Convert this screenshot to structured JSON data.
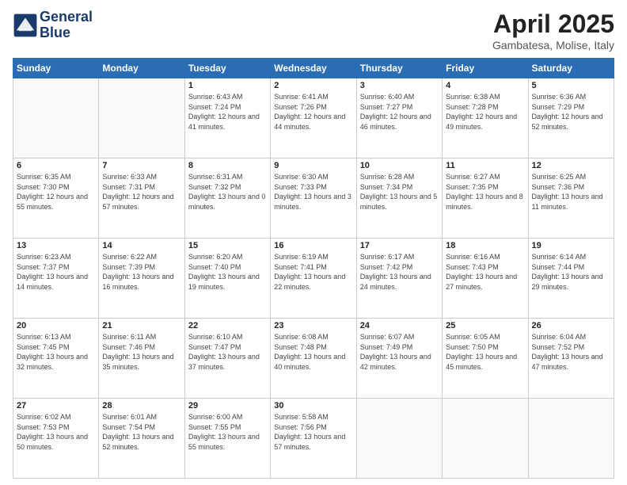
{
  "header": {
    "logo_line1": "General",
    "logo_line2": "Blue",
    "month_title": "April 2025",
    "location": "Gambatesa, Molise, Italy"
  },
  "days_of_week": [
    "Sunday",
    "Monday",
    "Tuesday",
    "Wednesday",
    "Thursday",
    "Friday",
    "Saturday"
  ],
  "weeks": [
    [
      {
        "day": "",
        "info": ""
      },
      {
        "day": "",
        "info": ""
      },
      {
        "day": "1",
        "info": "Sunrise: 6:43 AM\nSunset: 7:24 PM\nDaylight: 12 hours and 41 minutes."
      },
      {
        "day": "2",
        "info": "Sunrise: 6:41 AM\nSunset: 7:26 PM\nDaylight: 12 hours and 44 minutes."
      },
      {
        "day": "3",
        "info": "Sunrise: 6:40 AM\nSunset: 7:27 PM\nDaylight: 12 hours and 46 minutes."
      },
      {
        "day": "4",
        "info": "Sunrise: 6:38 AM\nSunset: 7:28 PM\nDaylight: 12 hours and 49 minutes."
      },
      {
        "day": "5",
        "info": "Sunrise: 6:36 AM\nSunset: 7:29 PM\nDaylight: 12 hours and 52 minutes."
      }
    ],
    [
      {
        "day": "6",
        "info": "Sunrise: 6:35 AM\nSunset: 7:30 PM\nDaylight: 12 hours and 55 minutes."
      },
      {
        "day": "7",
        "info": "Sunrise: 6:33 AM\nSunset: 7:31 PM\nDaylight: 12 hours and 57 minutes."
      },
      {
        "day": "8",
        "info": "Sunrise: 6:31 AM\nSunset: 7:32 PM\nDaylight: 13 hours and 0 minutes."
      },
      {
        "day": "9",
        "info": "Sunrise: 6:30 AM\nSunset: 7:33 PM\nDaylight: 13 hours and 3 minutes."
      },
      {
        "day": "10",
        "info": "Sunrise: 6:28 AM\nSunset: 7:34 PM\nDaylight: 13 hours and 5 minutes."
      },
      {
        "day": "11",
        "info": "Sunrise: 6:27 AM\nSunset: 7:35 PM\nDaylight: 13 hours and 8 minutes."
      },
      {
        "day": "12",
        "info": "Sunrise: 6:25 AM\nSunset: 7:36 PM\nDaylight: 13 hours and 11 minutes."
      }
    ],
    [
      {
        "day": "13",
        "info": "Sunrise: 6:23 AM\nSunset: 7:37 PM\nDaylight: 13 hours and 14 minutes."
      },
      {
        "day": "14",
        "info": "Sunrise: 6:22 AM\nSunset: 7:39 PM\nDaylight: 13 hours and 16 minutes."
      },
      {
        "day": "15",
        "info": "Sunrise: 6:20 AM\nSunset: 7:40 PM\nDaylight: 13 hours and 19 minutes."
      },
      {
        "day": "16",
        "info": "Sunrise: 6:19 AM\nSunset: 7:41 PM\nDaylight: 13 hours and 22 minutes."
      },
      {
        "day": "17",
        "info": "Sunrise: 6:17 AM\nSunset: 7:42 PM\nDaylight: 13 hours and 24 minutes."
      },
      {
        "day": "18",
        "info": "Sunrise: 6:16 AM\nSunset: 7:43 PM\nDaylight: 13 hours and 27 minutes."
      },
      {
        "day": "19",
        "info": "Sunrise: 6:14 AM\nSunset: 7:44 PM\nDaylight: 13 hours and 29 minutes."
      }
    ],
    [
      {
        "day": "20",
        "info": "Sunrise: 6:13 AM\nSunset: 7:45 PM\nDaylight: 13 hours and 32 minutes."
      },
      {
        "day": "21",
        "info": "Sunrise: 6:11 AM\nSunset: 7:46 PM\nDaylight: 13 hours and 35 minutes."
      },
      {
        "day": "22",
        "info": "Sunrise: 6:10 AM\nSunset: 7:47 PM\nDaylight: 13 hours and 37 minutes."
      },
      {
        "day": "23",
        "info": "Sunrise: 6:08 AM\nSunset: 7:48 PM\nDaylight: 13 hours and 40 minutes."
      },
      {
        "day": "24",
        "info": "Sunrise: 6:07 AM\nSunset: 7:49 PM\nDaylight: 13 hours and 42 minutes."
      },
      {
        "day": "25",
        "info": "Sunrise: 6:05 AM\nSunset: 7:50 PM\nDaylight: 13 hours and 45 minutes."
      },
      {
        "day": "26",
        "info": "Sunrise: 6:04 AM\nSunset: 7:52 PM\nDaylight: 13 hours and 47 minutes."
      }
    ],
    [
      {
        "day": "27",
        "info": "Sunrise: 6:02 AM\nSunset: 7:53 PM\nDaylight: 13 hours and 50 minutes."
      },
      {
        "day": "28",
        "info": "Sunrise: 6:01 AM\nSunset: 7:54 PM\nDaylight: 13 hours and 52 minutes."
      },
      {
        "day": "29",
        "info": "Sunrise: 6:00 AM\nSunset: 7:55 PM\nDaylight: 13 hours and 55 minutes."
      },
      {
        "day": "30",
        "info": "Sunrise: 5:58 AM\nSunset: 7:56 PM\nDaylight: 13 hours and 57 minutes."
      },
      {
        "day": "",
        "info": ""
      },
      {
        "day": "",
        "info": ""
      },
      {
        "day": "",
        "info": ""
      }
    ]
  ]
}
